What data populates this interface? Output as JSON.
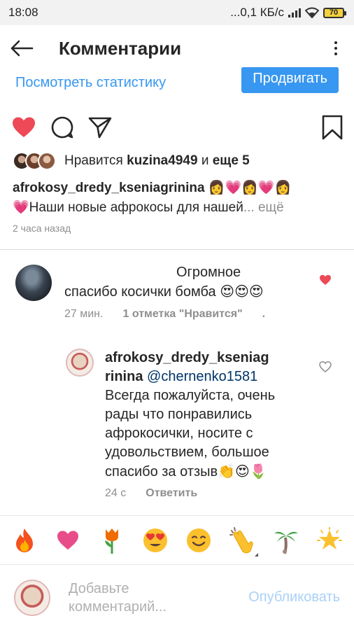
{
  "status_bar": {
    "time": "18:08",
    "network_speed": "...0,1 КБ/с",
    "battery_level": "70"
  },
  "header": {
    "back_icon": "arrow-left-icon",
    "title": "Комментарии",
    "menu_icon": "more-vertical-icon"
  },
  "promo": {
    "stats_link": "Посмотреть статистику",
    "promote_button": "Продвигать"
  },
  "post_actions": {
    "like_icon": "heart-filled-icon",
    "comment_icon": "comment-icon",
    "share_icon": "send-icon",
    "save_icon": "bookmark-icon",
    "like_color": "#ed4956"
  },
  "likes": {
    "prefix": "Нравится",
    "user": "kuzina4949",
    "conjunction": "и",
    "others": "еще 5"
  },
  "caption": {
    "username": "afrokosy_dredy_kseniagrinina",
    "emoji_after_name": "👩💗👩💗👩",
    "text": "💗Наши новые афрокосы для нашей",
    "ellipsis": "...",
    "more": "ещё"
  },
  "posted_time": "2 часа назад",
  "comments": [
    {
      "text_line1": "Огромное",
      "text_line2": "спасибо косички бомба",
      "emoji": "😍😍😍",
      "time": "27 мин.",
      "likes_label": "1 отметка \"Нравится\"",
      "trailing": ".",
      "liked": true
    },
    {
      "username_line1": "afrokosy_dredy_kseniag",
      "username_line2": "rinina",
      "mention": "@chernenko1581",
      "body_lines": [
        "Всегда пожалуйста, очень",
        "рады что понравились",
        "афрокосички, носите с",
        "удовольствием, большое",
        "спасибо за отзыв"
      ],
      "emoji": "👏😍🌷",
      "time": "24 с",
      "reply_label": "Ответить",
      "liked": false
    }
  ],
  "emoji_bar": [
    "🔥",
    "💗",
    "🌷",
    "😍",
    "😊",
    "👏",
    "🌴",
    "🌟"
  ],
  "composer": {
    "placeholder_line1": "Добавьте",
    "placeholder_line2": "комментарий...",
    "publish": "Опубликовать"
  },
  "colors": {
    "accent_blue": "#3897f0",
    "muted_blue": "#a9d1f7",
    "heart_red": "#ed4956",
    "text_gray": "#8e8e8e"
  }
}
